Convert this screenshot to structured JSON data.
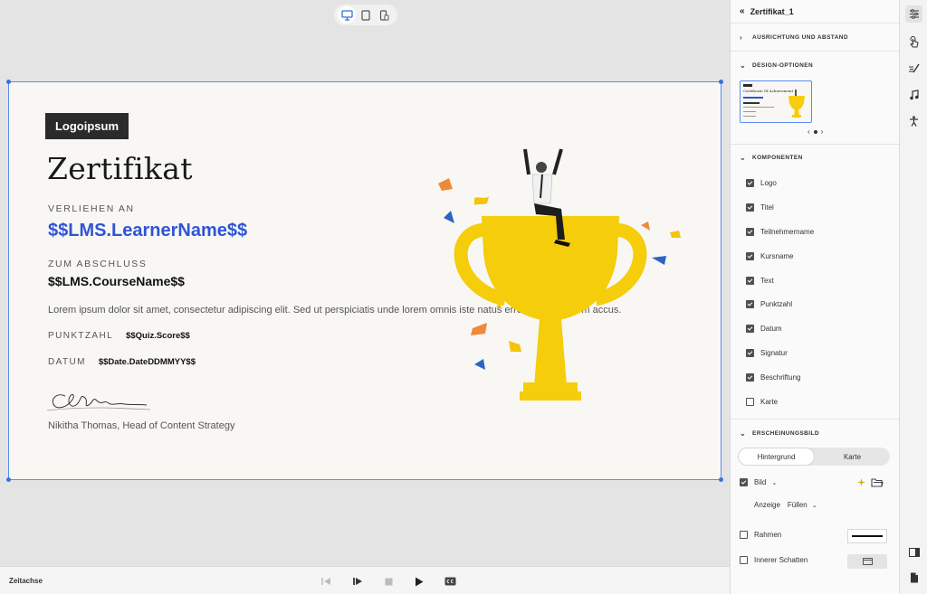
{
  "certificate": {
    "logo": "Logoipsum",
    "title": "Zertifikat",
    "awarded_to_label": "VERLIEHEN AN",
    "learner_name": "$$LMS.LearnerName$$",
    "completion_label": "ZUM ABSCHLUSS",
    "course_name": "$$LMS.CourseName$$",
    "body_text": "Lorem ipsum dolor sit amet, consectetur adipiscing elit. Sed ut perspiciatis unde lorem omnis iste natus error sit voluptatem accus.",
    "score_label": "PUNKTZAHL",
    "score_value": "$$Quiz.Score$$",
    "date_label": "DATUM",
    "date_value": "$$Date.DateDDMMYY$$",
    "signer": "Nikitha Thomas, Head of Content Strategy"
  },
  "timeline": {
    "label": "Zeitachse"
  },
  "panel": {
    "title": "Zertifikat_1",
    "sections": {
      "alignment": "AUSRICHTUNG UND ABSTAND",
      "design": "DESIGN-OPTIONEN",
      "components": "KOMPONENTEN",
      "appearance": "ERSCHEINUNGSBILD"
    },
    "thumbnail_title": "Certificate Of Achievement",
    "components": [
      {
        "label": "Logo",
        "checked": true
      },
      {
        "label": "Titel",
        "checked": true
      },
      {
        "label": "Teilnehmername",
        "checked": true
      },
      {
        "label": "Kursname",
        "checked": true
      },
      {
        "label": "Text",
        "checked": true
      },
      {
        "label": "Punktzahl",
        "checked": true
      },
      {
        "label": "Datum",
        "checked": true
      },
      {
        "label": "Signatur",
        "checked": true
      },
      {
        "label": "Beschriftung",
        "checked": true
      },
      {
        "label": "Karte",
        "checked": false
      }
    ],
    "appearance": {
      "tab_background": "Hintergrund",
      "tab_card": "Karte",
      "image_label": "Bild",
      "display_label": "Anzeige",
      "display_value": "Füllen",
      "border_label": "Rahmen",
      "inner_shadow_label": "Innerer Schatten"
    }
  },
  "colors": {
    "accent": "#2f55d4",
    "selection": "#5b8def",
    "trophy": "#f5cd0a"
  }
}
